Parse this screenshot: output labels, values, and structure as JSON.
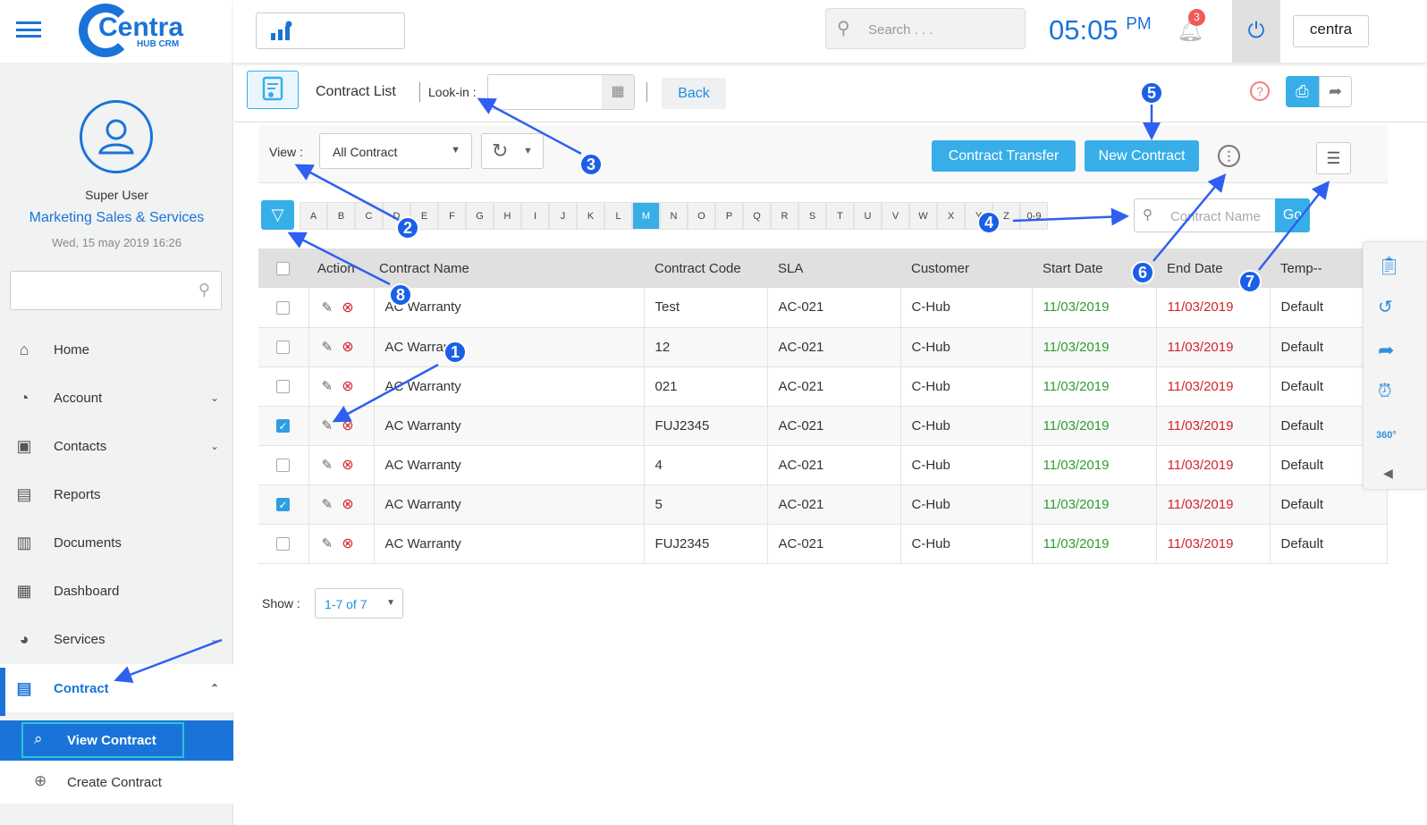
{
  "app": {
    "logo_text": "Centra",
    "logo_sub": "HUB CRM",
    "time": "05:05",
    "ampm": "PM",
    "notif_count": "3",
    "brand": "centra",
    "search_placeholder": "Search . . ."
  },
  "user": {
    "role": "Super User",
    "department": "Marketing Sales & Services",
    "datetime": "Wed, 15 may 2019 16:26"
  },
  "sidebar": {
    "items": [
      {
        "label": "Home",
        "icon": "⌂"
      },
      {
        "label": "Account",
        "icon": "◔"
      },
      {
        "label": "Contacts",
        "icon": "▣"
      },
      {
        "label": "Reports",
        "icon": "▤"
      },
      {
        "label": "Documents",
        "icon": "▥"
      },
      {
        "label": "Dashboard",
        "icon": "▦"
      },
      {
        "label": "Services",
        "icon": "◕"
      },
      {
        "label": "Contract",
        "icon": "▤"
      }
    ],
    "sub": [
      {
        "label": "View Contract"
      },
      {
        "label": "Create Contract"
      }
    ]
  },
  "toolbar": {
    "title": "Contract List",
    "lookin": "Look-in :",
    "back": "Back"
  },
  "filters": {
    "view_label": "View :",
    "view_value": "All Contract",
    "transfer": "Contract Transfer",
    "new": "New Contract",
    "letters": [
      "A",
      "B",
      "C",
      "D",
      "E",
      "F",
      "G",
      "H",
      "I",
      "J",
      "K",
      "L",
      "M",
      "N",
      "O",
      "P",
      "Q",
      "R",
      "S",
      "T",
      "U",
      "V",
      "W",
      "X",
      "Y",
      "Z",
      "0-9"
    ],
    "active_letter": "M",
    "search_placeholder": "Contract Name",
    "go": "Go"
  },
  "table": {
    "headers": [
      "Action",
      "Contract Name",
      "Contract Code",
      "SLA",
      "Customer",
      "Start Date",
      "End Date",
      "Temp--"
    ],
    "rows": [
      {
        "checked": false,
        "name": "AC Warranty",
        "code": "Test",
        "sla": "AC-021",
        "customer": "C-Hub",
        "start": "11/03/2019",
        "end": "11/03/2019",
        "temp": "Default"
      },
      {
        "checked": false,
        "name": "AC Warranty",
        "code": "12",
        "sla": "AC-021",
        "customer": "C-Hub",
        "start": "11/03/2019",
        "end": "11/03/2019",
        "temp": "Default"
      },
      {
        "checked": false,
        "name": "AC Warranty",
        "code": "021",
        "sla": "AC-021",
        "customer": "C-Hub",
        "start": "11/03/2019",
        "end": "11/03/2019",
        "temp": "Default"
      },
      {
        "checked": true,
        "name": "AC Warranty",
        "code": "FUJ2345",
        "sla": "AC-021",
        "customer": "C-Hub",
        "start": "11/03/2019",
        "end": "11/03/2019",
        "temp": "Default"
      },
      {
        "checked": false,
        "name": "AC Warranty",
        "code": "4",
        "sla": "AC-021",
        "customer": "C-Hub",
        "start": "11/03/2019",
        "end": "11/03/2019",
        "temp": "Default"
      },
      {
        "checked": true,
        "name": "AC Warranty",
        "code": "5",
        "sla": "AC-021",
        "customer": "C-Hub",
        "start": "11/03/2019",
        "end": "11/03/2019",
        "temp": "Default"
      },
      {
        "checked": false,
        "name": "AC Warranty",
        "code": "FUJ2345",
        "sla": "AC-021",
        "customer": "C-Hub",
        "start": "11/03/2019",
        "end": "11/03/2019",
        "temp": "Default"
      }
    ]
  },
  "pager": {
    "show": "Show :",
    "value": "1-7 of 7"
  },
  "annotations": [
    "1",
    "2",
    "3",
    "4",
    "5",
    "6",
    "7",
    "8"
  ]
}
